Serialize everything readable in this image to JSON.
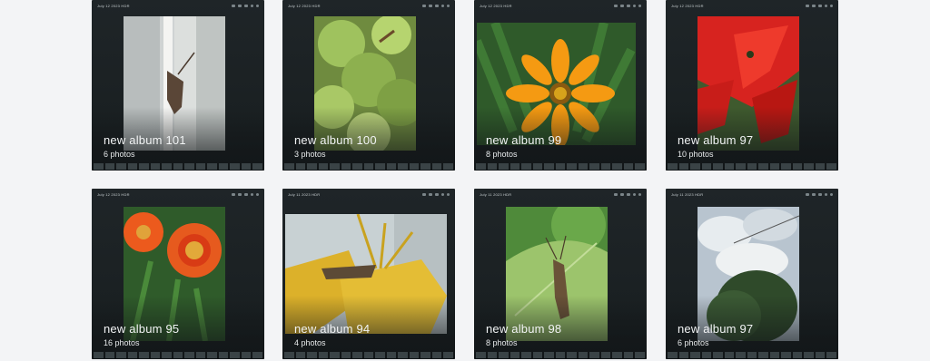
{
  "albums": [
    {
      "name": "new album 101",
      "count": "6 photos",
      "date": "July 12 2023 HDR"
    },
    {
      "name": "new album 100",
      "count": "3 photos",
      "date": "July 12 2023 HDR"
    },
    {
      "name": "new album 99",
      "count": "8 photos",
      "date": "July 12 2023 HDR"
    },
    {
      "name": "new album 97",
      "count": "10 photos",
      "date": "July 12 2023 HDR"
    },
    {
      "name": "new album 95",
      "count": "16 photos",
      "date": "July 12 2023 HDR"
    },
    {
      "name": "new album 94",
      "count": "4 photos",
      "date": "July 11 2023 HDR"
    },
    {
      "name": "new album 98",
      "count": "8 photos",
      "date": "July 11 2023 HDR"
    },
    {
      "name": "new album 97",
      "count": "6 photos",
      "date": "July 11 2023 HDR"
    }
  ],
  "theme": {
    "background": "#f3f4f6",
    "card": "#1f2528",
    "text": "#f2f4f5"
  },
  "icons": [
    "grasshopper-photo",
    "succulent-photo",
    "orange-flower-photo",
    "red-plant-photo",
    "orange-daisies-photo",
    "yellow-lily-photo",
    "grasshopper-leaf-photo",
    "sky-tree-photo"
  ]
}
